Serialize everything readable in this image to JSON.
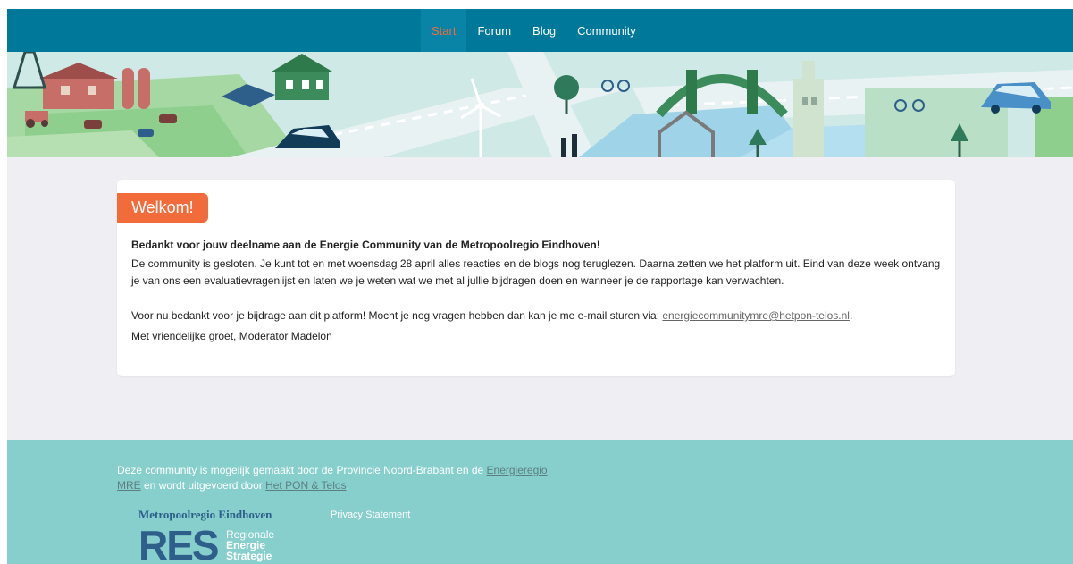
{
  "nav": {
    "items": [
      {
        "label": "Start",
        "active": true
      },
      {
        "label": "Forum",
        "active": false
      },
      {
        "label": "Blog",
        "active": false
      },
      {
        "label": "Community",
        "active": false
      }
    ]
  },
  "welcome": {
    "badge": "Welkom!",
    "lead": "Bedankt voor jouw deelname aan de Energie Community van de Metropoolregio Eindhoven!",
    "paragraph1": "De community is gesloten. Je kunt tot en met woensdag 28 april alles reacties en de blogs nog teruglezen. Daarna zetten we het platform uit. Eind van deze week ontvang je van ons een evaluatievragenlijst en laten we je weten wat we met al jullie bijdragen doen en wanneer je de rapportage kan verwachten.",
    "paragraph2_prefix": "Voor nu bedankt voor je bijdrage aan dit platform! Mocht je nog vragen hebben dan kan je me e-mail sturen via: ",
    "email": "energiecommunitymre@hetpon-telos.nl",
    "paragraph2_suffix": ".",
    "signoff": "Met vriendelijke groet, Moderator Madelon"
  },
  "footer": {
    "text_prefix": "Deze community is mogelijk gemaakt door de Provincie Noord-Brabant en de ",
    "link1": "Energieregio MRE",
    "text_middle": " en wordt uitgevoerd door ",
    "link2": "Het PON & Telos",
    "text_suffix": ".",
    "privacy": "Privacy Statement",
    "logo": {
      "line1": "Metropoolregio Eindhoven",
      "big": "RES",
      "sub1": "Regionale",
      "sub2": "Energie",
      "sub3": "Strategie"
    }
  },
  "colors": {
    "nav": "#00789a",
    "accent": "#f26b3a",
    "footer": "#86cfcc",
    "logo": "#2e5f8a"
  }
}
